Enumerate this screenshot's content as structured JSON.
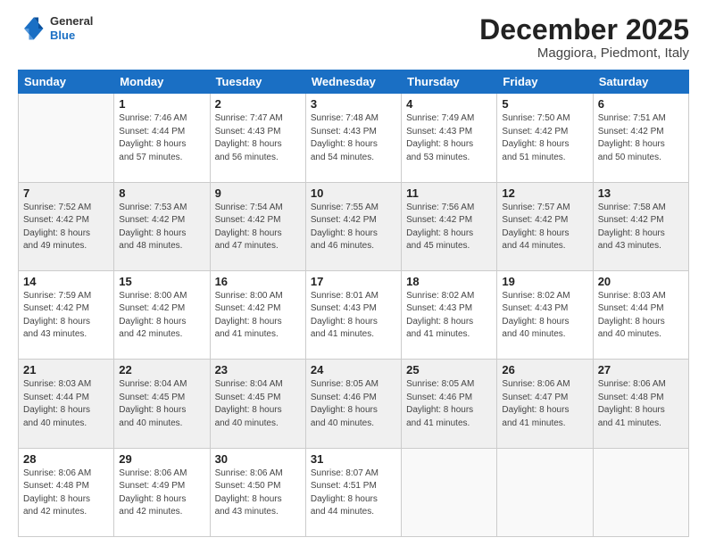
{
  "header": {
    "logo": {
      "general": "General",
      "blue": "Blue"
    },
    "title": "December 2025",
    "subtitle": "Maggiora, Piedmont, Italy"
  },
  "calendar": {
    "headers": [
      "Sunday",
      "Monday",
      "Tuesday",
      "Wednesday",
      "Thursday",
      "Friday",
      "Saturday"
    ],
    "rows": [
      [
        {
          "day": "",
          "info": ""
        },
        {
          "day": "1",
          "info": "Sunrise: 7:46 AM\nSunset: 4:44 PM\nDaylight: 8 hours\nand 57 minutes."
        },
        {
          "day": "2",
          "info": "Sunrise: 7:47 AM\nSunset: 4:43 PM\nDaylight: 8 hours\nand 56 minutes."
        },
        {
          "day": "3",
          "info": "Sunrise: 7:48 AM\nSunset: 4:43 PM\nDaylight: 8 hours\nand 54 minutes."
        },
        {
          "day": "4",
          "info": "Sunrise: 7:49 AM\nSunset: 4:43 PM\nDaylight: 8 hours\nand 53 minutes."
        },
        {
          "day": "5",
          "info": "Sunrise: 7:50 AM\nSunset: 4:42 PM\nDaylight: 8 hours\nand 51 minutes."
        },
        {
          "day": "6",
          "info": "Sunrise: 7:51 AM\nSunset: 4:42 PM\nDaylight: 8 hours\nand 50 minutes."
        }
      ],
      [
        {
          "day": "7",
          "info": "Sunrise: 7:52 AM\nSunset: 4:42 PM\nDaylight: 8 hours\nand 49 minutes."
        },
        {
          "day": "8",
          "info": "Sunrise: 7:53 AM\nSunset: 4:42 PM\nDaylight: 8 hours\nand 48 minutes."
        },
        {
          "day": "9",
          "info": "Sunrise: 7:54 AM\nSunset: 4:42 PM\nDaylight: 8 hours\nand 47 minutes."
        },
        {
          "day": "10",
          "info": "Sunrise: 7:55 AM\nSunset: 4:42 PM\nDaylight: 8 hours\nand 46 minutes."
        },
        {
          "day": "11",
          "info": "Sunrise: 7:56 AM\nSunset: 4:42 PM\nDaylight: 8 hours\nand 45 minutes."
        },
        {
          "day": "12",
          "info": "Sunrise: 7:57 AM\nSunset: 4:42 PM\nDaylight: 8 hours\nand 44 minutes."
        },
        {
          "day": "13",
          "info": "Sunrise: 7:58 AM\nSunset: 4:42 PM\nDaylight: 8 hours\nand 43 minutes."
        }
      ],
      [
        {
          "day": "14",
          "info": "Sunrise: 7:59 AM\nSunset: 4:42 PM\nDaylight: 8 hours\nand 43 minutes."
        },
        {
          "day": "15",
          "info": "Sunrise: 8:00 AM\nSunset: 4:42 PM\nDaylight: 8 hours\nand 42 minutes."
        },
        {
          "day": "16",
          "info": "Sunrise: 8:00 AM\nSunset: 4:42 PM\nDaylight: 8 hours\nand 41 minutes."
        },
        {
          "day": "17",
          "info": "Sunrise: 8:01 AM\nSunset: 4:43 PM\nDaylight: 8 hours\nand 41 minutes."
        },
        {
          "day": "18",
          "info": "Sunrise: 8:02 AM\nSunset: 4:43 PM\nDaylight: 8 hours\nand 41 minutes."
        },
        {
          "day": "19",
          "info": "Sunrise: 8:02 AM\nSunset: 4:43 PM\nDaylight: 8 hours\nand 40 minutes."
        },
        {
          "day": "20",
          "info": "Sunrise: 8:03 AM\nSunset: 4:44 PM\nDaylight: 8 hours\nand 40 minutes."
        }
      ],
      [
        {
          "day": "21",
          "info": "Sunrise: 8:03 AM\nSunset: 4:44 PM\nDaylight: 8 hours\nand 40 minutes."
        },
        {
          "day": "22",
          "info": "Sunrise: 8:04 AM\nSunset: 4:45 PM\nDaylight: 8 hours\nand 40 minutes."
        },
        {
          "day": "23",
          "info": "Sunrise: 8:04 AM\nSunset: 4:45 PM\nDaylight: 8 hours\nand 40 minutes."
        },
        {
          "day": "24",
          "info": "Sunrise: 8:05 AM\nSunset: 4:46 PM\nDaylight: 8 hours\nand 40 minutes."
        },
        {
          "day": "25",
          "info": "Sunrise: 8:05 AM\nSunset: 4:46 PM\nDaylight: 8 hours\nand 41 minutes."
        },
        {
          "day": "26",
          "info": "Sunrise: 8:06 AM\nSunset: 4:47 PM\nDaylight: 8 hours\nand 41 minutes."
        },
        {
          "day": "27",
          "info": "Sunrise: 8:06 AM\nSunset: 4:48 PM\nDaylight: 8 hours\nand 41 minutes."
        }
      ],
      [
        {
          "day": "28",
          "info": "Sunrise: 8:06 AM\nSunset: 4:48 PM\nDaylight: 8 hours\nand 42 minutes."
        },
        {
          "day": "29",
          "info": "Sunrise: 8:06 AM\nSunset: 4:49 PM\nDaylight: 8 hours\nand 42 minutes."
        },
        {
          "day": "30",
          "info": "Sunrise: 8:06 AM\nSunset: 4:50 PM\nDaylight: 8 hours\nand 43 minutes."
        },
        {
          "day": "31",
          "info": "Sunrise: 8:07 AM\nSunset: 4:51 PM\nDaylight: 8 hours\nand 44 minutes."
        },
        {
          "day": "",
          "info": ""
        },
        {
          "day": "",
          "info": ""
        },
        {
          "day": "",
          "info": ""
        }
      ]
    ]
  }
}
